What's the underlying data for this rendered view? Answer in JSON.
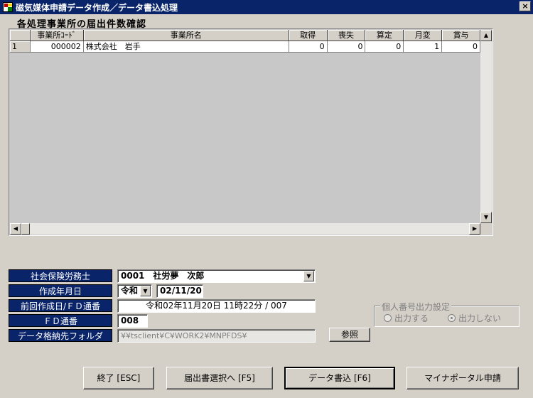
{
  "window": {
    "title": "磁気媒体申請データ作成／データ書込処理",
    "close_glyph": "×"
  },
  "section_heading": "各処理事業所の届出件数確認",
  "grid": {
    "columns": [
      "",
      "事業所ｺｰﾄﾞ",
      "事業所名",
      "取得",
      "喪失",
      "算定",
      "月変",
      "賞与"
    ],
    "rows": [
      [
        "1",
        "000002",
        "株式会社　岩手",
        "0",
        "0",
        "0",
        "1",
        "0"
      ]
    ]
  },
  "form": {
    "labels": {
      "sharoushi": "社会保険労務士",
      "created_date": "作成年月日",
      "prev_created": "前回作成日/ＦＤ通番",
      "fd_number": "ＦＤ通番",
      "data_folder": "データ格納先フォルダ"
    },
    "sharoushi_value": "0001　社労夢　次郎",
    "era_value": "令和",
    "date_value": "02/11/20",
    "prev_created_value": "令和02年11月20日 11時22分 / 007",
    "fd_number_value": "008",
    "folder_value": "¥¥tsclient¥C¥WORK2¥MNPFDS¥",
    "browse_button": "参照"
  },
  "mynumber_group": {
    "title": "個人番号出力設定",
    "option_output": "出力する",
    "option_no_output": "出力しない",
    "selected": "出力しない"
  },
  "buttons": {
    "exit": "終了 [ESC]",
    "select_forms": "届出書選択へ [F5]",
    "write_data": "データ書込 [F6]",
    "mynaportal": "マイナポータル申請"
  },
  "colors": {
    "title_bar": "#0a246a",
    "label_bg": "#0a246a",
    "dialog_bg": "#d4d0c8"
  }
}
